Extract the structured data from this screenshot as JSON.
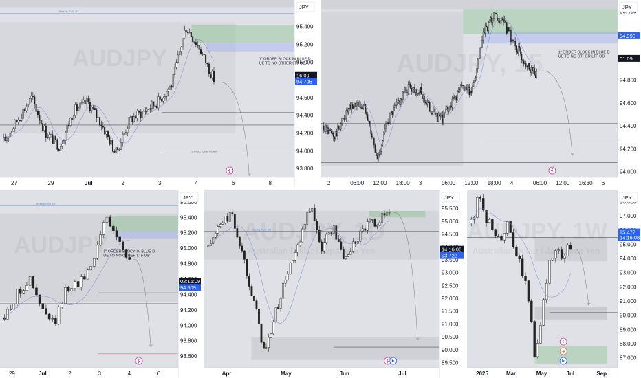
{
  "panels": [
    {
      "id": "p1",
      "currency": "JPY",
      "watermark": "AUDJPY",
      "watermark_sub": "",
      "price_ticks": [
        "95.600",
        "95.400",
        "95.200",
        "95.000",
        "94.800",
        "94.600",
        "94.400",
        "94.200",
        "94.000",
        "93.800"
      ],
      "time_ticks": [
        "27",
        "29",
        "Jul",
        "2",
        "3",
        "4",
        "6",
        "8"
      ],
      "price_tags": [
        {
          "text": "16:09",
          "bg": "#131722",
          "fg": "#ffffff"
        },
        {
          "text": "94.795",
          "bg": "#2962ff",
          "fg": "#ffffff"
        }
      ],
      "annotation": "1\" ORDER BLOCK IN BLUE DUE TO NO OTHER LTF OB",
      "labels": [
        "Weekly FVG 4H",
        "STRUCTURE POINT"
      ],
      "icons": [
        "tradingview-flash-icon"
      ]
    },
    {
      "id": "p2",
      "currency": "JPY",
      "watermark": "AUDJPY, 15",
      "watermark_sub": "",
      "price_ticks": [
        "95.400",
        "95.200",
        "95.000",
        "94.800",
        "94.600",
        "94.400",
        "94.200",
        "94.000"
      ],
      "time_ticks": [
        "2",
        "06:00",
        "12:00",
        "18:00",
        "3",
        "06:00",
        "12:00",
        "18:00",
        "4",
        "06:00",
        "12:00",
        "16:30",
        "6"
      ],
      "price_tags": [
        {
          "text": "94.990",
          "bg": "#2962ff",
          "fg": "#ffffff"
        },
        {
          "text": "01:09",
          "bg": "#131722",
          "fg": "#ffffff"
        }
      ],
      "annotation": "1\" ORDER BLOCK IN BLUE DUE TO NO OTHER LTF OB",
      "labels": [],
      "icons": [
        "tradingview-flash-icon"
      ]
    },
    {
      "id": "p3",
      "currency": "JPY",
      "watermark": "AUDJPY",
      "watermark_sub": "",
      "price_ticks": [
        "95.600",
        "95.400",
        "95.200",
        "95.000",
        "94.800",
        "94.600",
        "94.400",
        "94.200",
        "94.000",
        "93.800",
        "93.600"
      ],
      "time_ticks": [
        "29",
        "Jul",
        "2",
        "3",
        "4",
        "6"
      ],
      "price_tags": [
        {
          "text": "02:16:09",
          "bg": "#131722",
          "fg": "#ffffff"
        },
        {
          "text": "94.509",
          "bg": "#2962ff",
          "fg": "#ffffff"
        }
      ],
      "annotation": "1\" ORDER BLOCK IN BLUE DUE TO NO OTHER LTF OB",
      "labels": [
        "Weekly FVG 4H"
      ],
      "icons": [
        "tradingview-flash-icon"
      ]
    },
    {
      "id": "p4",
      "currency": "JPY",
      "watermark": "AUDJPY, 1D",
      "watermark_sub": "Australian Dollar / Japanese Yen",
      "price_ticks": [
        "96.000",
        "95.500",
        "95.000",
        "94.500",
        "94.000",
        "93.500",
        "93.000",
        "92.500",
        "92.000",
        "91.500",
        "91.000",
        "90.500",
        "90.000",
        "89.500"
      ],
      "time_ticks": [
        "Apr",
        "May",
        "Jun",
        "Jul"
      ],
      "price_tags": [
        {
          "text": "14:16:08",
          "bg": "#131722",
          "fg": "#ffffff"
        },
        {
          "text": "93.722",
          "bg": "#2962ff",
          "fg": "#ffffff"
        }
      ],
      "annotation": "",
      "labels": [
        "Weekly FVG 4H"
      ],
      "icons": [
        "tradingview-flash-icon",
        "replay-icon"
      ]
    },
    {
      "id": "p5",
      "currency": "JPY",
      "watermark": "AUDJPY, 1W",
      "watermark_sub": "Australian Dollar / Japanese Yen",
      "price_ticks": [
        "98.000",
        "97.000",
        "96.000",
        "95.000",
        "94.000",
        "93.000",
        "92.000",
        "91.000",
        "90.000",
        "89.000",
        "88.000",
        "87.000"
      ],
      "time_ticks": [
        "2025",
        "Mar",
        "May",
        "Jul",
        "Sep"
      ],
      "price_tags": [
        {
          "text": "95.477",
          "bg": "#2962ff",
          "fg": "#ffffff"
        },
        {
          "text": "14:16:08",
          "bg": "#2962ff",
          "fg": "#ffffff"
        }
      ],
      "annotation": "",
      "labels": [],
      "icons": [
        "tradingview-flash-icon",
        "target-icon",
        "replay-icon"
      ]
    }
  ],
  "chart_data": [
    {
      "type": "candlestick",
      "panel": "p1",
      "title": "",
      "ylim": [
        93.7,
        95.7
      ],
      "price_scale_ticks": [
        95.6,
        95.4,
        95.2,
        95.0,
        94.8,
        94.6,
        94.4,
        94.2,
        94.0,
        93.8
      ],
      "current_price": 94.795,
      "key_levels": [
        95.55,
        94.43,
        94.29,
        94.0,
        93.64
      ],
      "trend_path": [
        94.1,
        94.35,
        94.6,
        94.2,
        94.05,
        94.45,
        94.55,
        94.3,
        93.97,
        94.35,
        94.45,
        94.55,
        94.75,
        95.4,
        95.15,
        94.8
      ]
    },
    {
      "type": "candlestick",
      "panel": "p2",
      "title": "",
      "ylim": [
        93.95,
        95.5
      ],
      "price_scale_ticks": [
        95.4,
        95.2,
        95.0,
        94.8,
        94.6,
        94.4,
        94.2,
        94.0
      ],
      "current_price": 94.99,
      "key_levels": [
        94.42,
        94.26,
        94.08
      ],
      "trend_path": [
        94.4,
        94.3,
        94.5,
        94.6,
        94.55,
        94.1,
        94.45,
        94.6,
        94.75,
        94.7,
        94.55,
        94.45,
        94.6,
        94.75,
        94.7,
        95.2,
        95.35,
        95.28,
        95.1,
        94.95,
        94.85
      ]
    },
    {
      "type": "candlestick",
      "panel": "p3",
      "title": "",
      "ylim": [
        93.45,
        95.75
      ],
      "price_scale_ticks": [
        95.6,
        95.4,
        95.2,
        95.0,
        94.8,
        94.6,
        94.4,
        94.2,
        94.0,
        93.8,
        93.6
      ],
      "current_price": 94.509,
      "key_levels": [
        95.55,
        94.42,
        94.28,
        93.63
      ],
      "trend_path": [
        94.1,
        94.4,
        94.6,
        94.2,
        94.0,
        94.5,
        94.55,
        94.8,
        95.4,
        95.15,
        94.85
      ]
    },
    {
      "type": "candlestick",
      "panel": "p4",
      "title": "",
      "ylim": [
        89.3,
        96.2
      ],
      "price_scale_ticks": [
        96.0,
        95.5,
        95.0,
        94.5,
        94.0,
        93.5,
        93.0,
        92.5,
        92.0,
        91.5,
        91.0,
        90.5,
        90.0,
        89.5
      ],
      "current_price": 93.722,
      "key_levels": [
        94.6,
        90.1
      ],
      "trend_path": [
        94.0,
        94.8,
        95.3,
        93.8,
        92.0,
        89.8,
        91.5,
        93.0,
        94.0,
        95.6,
        94.0,
        94.8,
        93.5,
        94.2,
        94.8,
        95.0,
        95.4
      ]
    },
    {
      "type": "candlestick",
      "panel": "p5",
      "title": "",
      "ylim": [
        86.3,
        98.8
      ],
      "price_scale_ticks": [
        98.0,
        97.0,
        96.0,
        95.0,
        94.0,
        93.0,
        92.0,
        91.0,
        90.0,
        89.0,
        88.0,
        87.0
      ],
      "current_price": 95.477,
      "key_levels": [
        95.48,
        90.2
      ],
      "trend_path": [
        96.5,
        98.2,
        97.0,
        96.0,
        95.2,
        96.5,
        94.6,
        93.5,
        91.5,
        87.0,
        90.5,
        93.5,
        94.5,
        94.0,
        95.0
      ]
    }
  ]
}
